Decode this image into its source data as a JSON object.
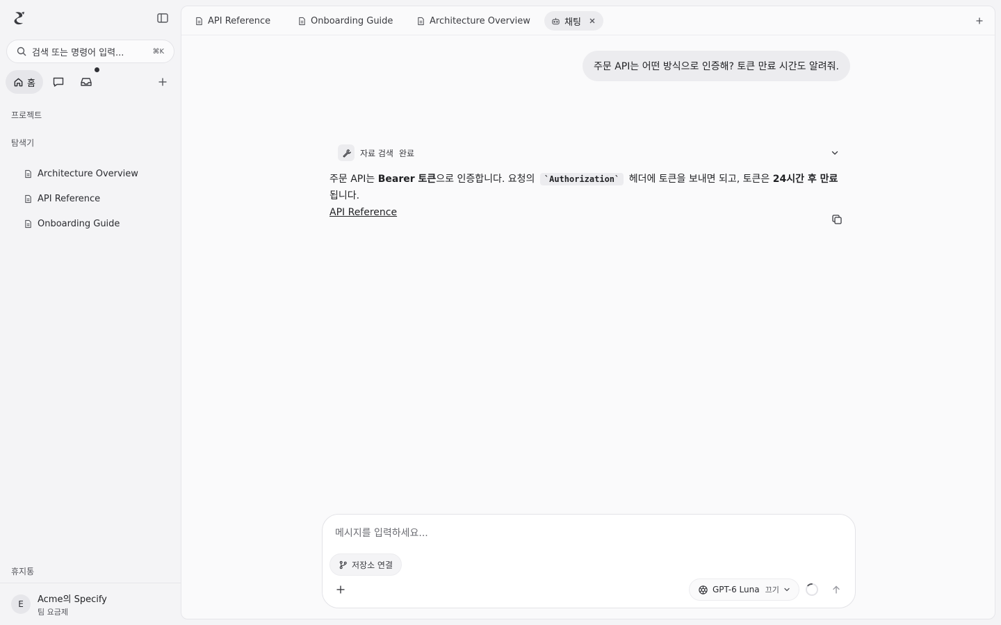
{
  "sidebar": {
    "search_placeholder": "검색 또는 명령어 입력...",
    "search_shortcut": "⌘K",
    "nav": {
      "home_label": "홈"
    },
    "sections": {
      "projects": "프로젝트",
      "explorer": "탐색기",
      "trash": "휴지통"
    },
    "explorer_items": [
      {
        "label": "Architecture Overview"
      },
      {
        "label": "API Reference"
      },
      {
        "label": "Onboarding Guide"
      }
    ],
    "account": {
      "avatar_initial": "E",
      "name": "Acme의 Specify",
      "plan": "팀 요금제"
    }
  },
  "tabs": [
    {
      "label": "API Reference",
      "icon": "document-icon",
      "active": false
    },
    {
      "label": "Onboarding Guide",
      "icon": "document-icon",
      "active": false
    },
    {
      "label": "Architecture Overview",
      "icon": "document-icon",
      "active": false
    },
    {
      "label": "채팅",
      "icon": "bot-icon",
      "active": true
    }
  ],
  "chat": {
    "user_message": "주문 API는 어떤 방식으로 인증해? 토큰 만료 시간도 알려줘.",
    "tool_call": {
      "name": "자료 검색",
      "status": "완료"
    },
    "answer": {
      "p1": "주문 API는 ",
      "b1": "Bearer 토큰",
      "p2": "으로 인증합니다. 요청의 ",
      "code": "`Authorization`",
      "p3": " 헤더에 토큰을 보내면 되고, 토큰은 ",
      "b2": "24시간 후 만료",
      "p4": "됩니다.",
      "source_link": "API Reference"
    }
  },
  "composer": {
    "placeholder": "메시지를 입력하세요...",
    "repo_button": "저장소 연결",
    "model_name": "GPT-6 Luna",
    "model_mode": "끄기"
  },
  "colors": {
    "background": "#f4f4f6",
    "panel": "#fafafb",
    "bubble": "#ececef",
    "text": "#1f2023"
  }
}
